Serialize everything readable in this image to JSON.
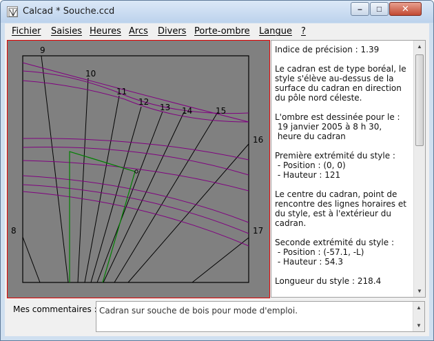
{
  "window": {
    "title": "Calcad * Souche.ccd",
    "min_symbol": "–",
    "max_symbol": "□",
    "close_symbol": "✕"
  },
  "menu": {
    "items": [
      "Fichier",
      "Saisies",
      "Heures",
      "Arcs",
      "Divers",
      "Porte-ombre",
      "Langue",
      "?"
    ]
  },
  "dial": {
    "hour_labels": [
      "8",
      "9",
      "10",
      "11",
      "12",
      "13",
      "14",
      "15",
      "16",
      "17"
    ],
    "colors": {
      "background": "#808080",
      "frame": "#000000",
      "hour_lines": "#000000",
      "date_arcs": "#800080",
      "shadow": "#008000",
      "border": "#e00000"
    }
  },
  "info": {
    "text": "Indice de précision : 1.39\n\nLe cadran est de type boréal, le style s'élève au-dessus de la surface du cadran en direction du pôle nord céleste.\n\nL'ombre est dessinée pour le :\n 19 janvier 2005 à 8 h 30,\n heure du cadran\n\nPremière extrémité du style :\n - Position : (0, 0)\n - Hauteur : 121\n\nLe centre du cadran, point de rencontre des lignes horaires et du style, est à l'extérieur du cadran.\n\nSeconde extrémité du style :\n - Position : (-57.1, -L)\n - Hauteur : 54.3\n\nLongueur du style : 218.4"
  },
  "comments": {
    "label": "Mes commentaires :",
    "value": "Cadran sur souche de bois pour mode d'emploi."
  },
  "icons": {
    "scroll_up": "▲",
    "scroll_down": "▼"
  }
}
